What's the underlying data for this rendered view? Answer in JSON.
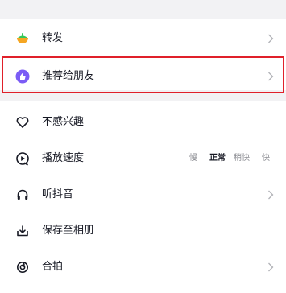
{
  "menu": {
    "items": [
      {
        "label": "转发",
        "icon": "share-bowl-icon",
        "has_arrow": true
      },
      {
        "label": "推荐给朋友",
        "icon": "recommend-friend-icon",
        "has_arrow": true,
        "highlighted": true
      },
      {
        "label": "不感兴趣",
        "icon": "heart-outline-icon",
        "has_arrow": false
      },
      {
        "label": "播放速度",
        "icon": "playback-speed-icon",
        "has_arrow": false
      },
      {
        "label": "听抖音",
        "icon": "headphones-icon",
        "has_arrow": true
      },
      {
        "label": "保存至相册",
        "icon": "download-icon",
        "has_arrow": false
      },
      {
        "label": "合拍",
        "icon": "duet-icon",
        "has_arrow": true
      }
    ]
  },
  "playback_speed": {
    "options": [
      "慢",
      "正常",
      "稍快",
      "快"
    ],
    "selected": "正常"
  },
  "colors": {
    "highlight_border": "#e0202a",
    "recommend_icon": "#7b5cf5",
    "share_icon_top": "#f5a623",
    "share_icon_bottom": "#34c759",
    "text_primary": "#161823",
    "text_secondary": "#8a8b91",
    "background": "#f2f2f4"
  }
}
